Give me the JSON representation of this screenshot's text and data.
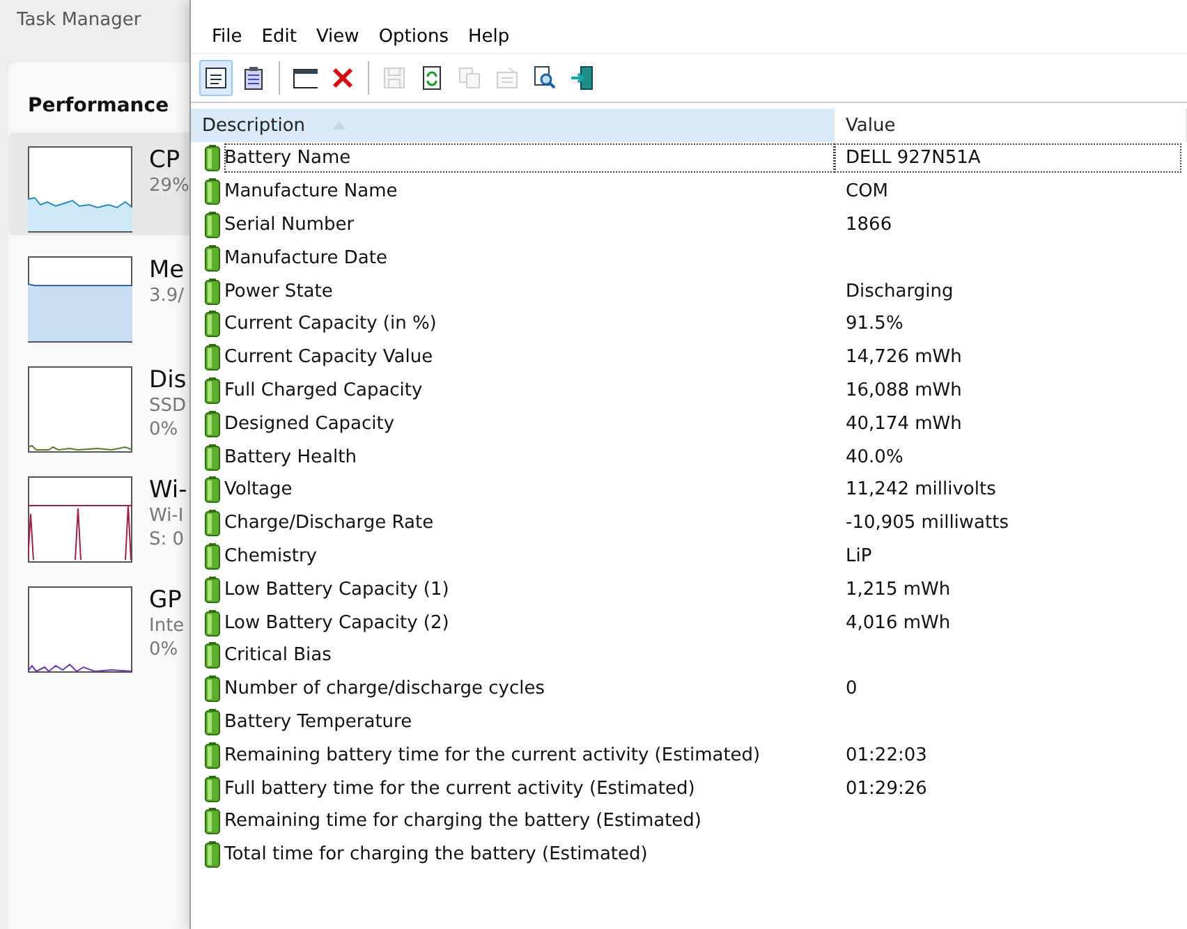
{
  "task_manager": {
    "title": "Task Manager",
    "section": "Performance",
    "items": [
      {
        "kind": "cpu",
        "name": "CP",
        "lines": [
          "29%"
        ],
        "selected": true
      },
      {
        "kind": "memory",
        "name": "Me",
        "lines": [
          "3.9/"
        ],
        "selected": false
      },
      {
        "kind": "disk",
        "name": "Dis",
        "lines": [
          "SSD",
          "0%"
        ],
        "selected": false
      },
      {
        "kind": "wifi",
        "name": "Wi-",
        "lines": [
          "Wi-I",
          "S: 0"
        ],
        "selected": false
      },
      {
        "kind": "gpu",
        "name": "GP",
        "lines": [
          "Inte",
          "0%"
        ],
        "selected": false
      }
    ]
  },
  "menu": [
    "File",
    "Edit",
    "View",
    "Options",
    "Help"
  ],
  "toolbar": [
    {
      "kind": "details",
      "selected": true,
      "disabled": false
    },
    {
      "kind": "clipboard",
      "selected": false,
      "disabled": false
    },
    {
      "kind": "separator"
    },
    {
      "kind": "window",
      "selected": false,
      "disabled": false
    },
    {
      "kind": "delete",
      "selected": false,
      "disabled": false
    },
    {
      "kind": "separator"
    },
    {
      "kind": "save",
      "selected": false,
      "disabled": true
    },
    {
      "kind": "refresh",
      "selected": false,
      "disabled": false
    },
    {
      "kind": "copy",
      "selected": false,
      "disabled": true
    },
    {
      "kind": "properties",
      "selected": false,
      "disabled": true
    },
    {
      "kind": "find",
      "selected": false,
      "disabled": false
    },
    {
      "kind": "exit",
      "selected": false,
      "disabled": false
    }
  ],
  "table": {
    "columns": [
      "Description",
      "Value"
    ],
    "rows": [
      {
        "description": "Battery Name",
        "value": "DELL 927N51A",
        "selected": true
      },
      {
        "description": "Manufacture Name",
        "value": "COM",
        "selected": false
      },
      {
        "description": "Serial Number",
        "value": "1866",
        "selected": false
      },
      {
        "description": "Manufacture Date",
        "selected": false
      },
      {
        "description": "Power State",
        "value": "Discharging",
        "selected": false
      },
      {
        "description": "Current Capacity (in %)",
        "value": "91.5%",
        "selected": false
      },
      {
        "description": "Current Capacity Value",
        "value": "14,726 mWh",
        "selected": false
      },
      {
        "description": "Full Charged Capacity",
        "value": "16,088 mWh",
        "selected": false
      },
      {
        "description": "Designed Capacity",
        "value": "40,174 mWh",
        "selected": false
      },
      {
        "description": "Battery Health",
        "value": "40.0%",
        "selected": false
      },
      {
        "description": "Voltage",
        "value": "11,242 millivolts",
        "selected": false
      },
      {
        "description": "Charge/Discharge Rate",
        "value": "-10,905 milliwatts",
        "selected": false
      },
      {
        "description": "Chemistry",
        "value": "LiP",
        "selected": false
      },
      {
        "description": "Low Battery Capacity (1)",
        "value": "1,215 mWh",
        "selected": false
      },
      {
        "description": "Low Battery Capacity (2)",
        "value": "4,016 mWh",
        "selected": false
      },
      {
        "description": "Critical Bias",
        "selected": false
      },
      {
        "description": "Number of charge/discharge cycles",
        "value": "0",
        "selected": false
      },
      {
        "description": "Battery Temperature",
        "selected": false
      },
      {
        "description": "Remaining battery time for the current activity (Estimated)",
        "value": "01:22:03",
        "selected": false
      },
      {
        "description": "Full battery time for the current activity (Estimated)",
        "value": "01:29:26",
        "selected": false
      },
      {
        "description": "Remaining time for charging the battery (Estimated)",
        "selected": false
      },
      {
        "description": "Total  time for charging the battery (Estimated)",
        "selected": false
      }
    ]
  }
}
